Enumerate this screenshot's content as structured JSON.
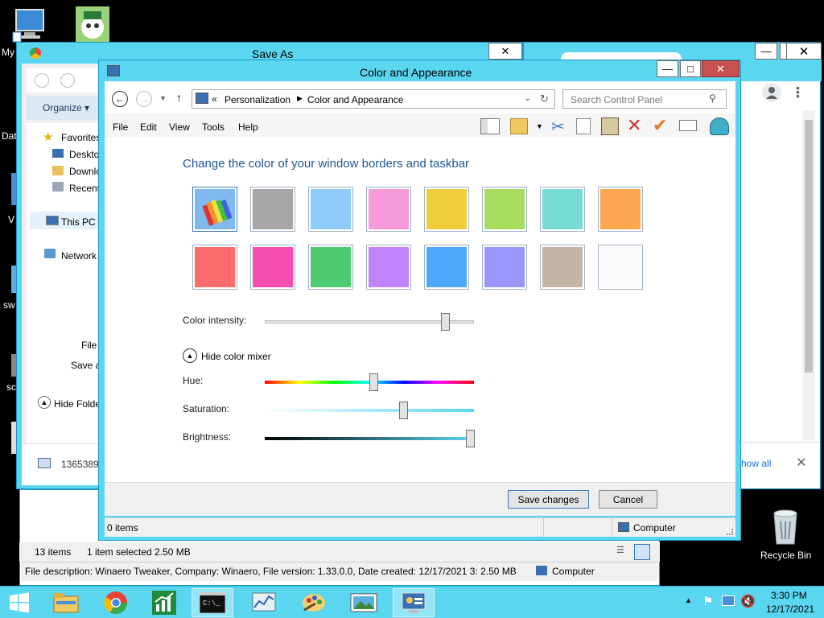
{
  "desktop": {
    "left_labels": [
      "My",
      "Dat",
      "V",
      "sw",
      "sc"
    ],
    "recycle_bin_label": "Recycle Bin"
  },
  "save_as": {
    "title": "Save As",
    "toolbar": {
      "organize": "Organize"
    },
    "nav": [
      {
        "label": "Favorites",
        "icon": "star-icon"
      },
      {
        "label": "Deskto",
        "icon": "desktop-icon"
      },
      {
        "label": "Downlo",
        "icon": "downloads-icon"
      },
      {
        "label": "Recent",
        "icon": "recent-icon"
      },
      {
        "label": "This PC",
        "icon": "computer-icon"
      },
      {
        "label": "Network",
        "icon": "network-icon"
      }
    ],
    "file_label": "File",
    "save_as_label": "Save as",
    "hide_folders": "Hide Folde"
  },
  "chrome": {
    "download_name": "1365389",
    "show_all": "how all"
  },
  "explorer_status": {
    "items": "13 items",
    "selected": "1 item selected  2.50 MB",
    "description": "File description: Winaero Tweaker, Company: Winaero, File version: 1.33.0.0, Date created: 12/17/2021 3:  2.50 MB",
    "computer": "Computer"
  },
  "cpl": {
    "title": "Color and Appearance",
    "breadcrumb_prefix": "«",
    "breadcrumb": [
      "Personalization",
      "Color and Appearance"
    ],
    "search_placeholder": "Search Control Panel",
    "menu": [
      "File",
      "Edit",
      "View",
      "Tools",
      "Help"
    ],
    "heading": "Change the color of your window borders and taskbar",
    "swatches": [
      {
        "color": "#80b8f0",
        "name": "automatic"
      },
      {
        "color": "#a6a6a6"
      },
      {
        "color": "#8ecbfb"
      },
      {
        "color": "#f49ad8"
      },
      {
        "color": "#f0cd3a"
      },
      {
        "color": "#a8dc5e"
      },
      {
        "color": "#78dad5"
      },
      {
        "color": "#fea751"
      },
      {
        "color": "#fc6c6d"
      },
      {
        "color": "#f44fb0"
      },
      {
        "color": "#4fcc73"
      },
      {
        "color": "#c083f9"
      },
      {
        "color": "#4da8fa"
      },
      {
        "color": "#9a96fb"
      },
      {
        "color": "#c4b4a6"
      },
      {
        "color": "#fafafa"
      }
    ],
    "intensity_label": "Color intensity:",
    "intensity_value": 0.86,
    "mixer_toggle": "Hide color mixer",
    "hue_label": "Hue:",
    "hue_value": 0.52,
    "saturation_label": "Saturation:",
    "saturation_value": 0.66,
    "brightness_label": "Brightness:",
    "brightness_value": 0.98,
    "save_button": "Save changes",
    "cancel_button": "Cancel",
    "status_items": "0 items",
    "status_computer": "Computer",
    "accent": "#5ad6f0",
    "heading_color": "#1e5799"
  },
  "taskbar": {
    "time": "3:30 PM",
    "date": "12/17/2021",
    "apps": [
      "start-icon",
      "file-explorer-icon",
      "chrome-icon",
      "chart-app-icon",
      "cmd-icon",
      "perfmon-icon",
      "paint-icon",
      "photos-icon",
      "control-panel-icon"
    ]
  }
}
